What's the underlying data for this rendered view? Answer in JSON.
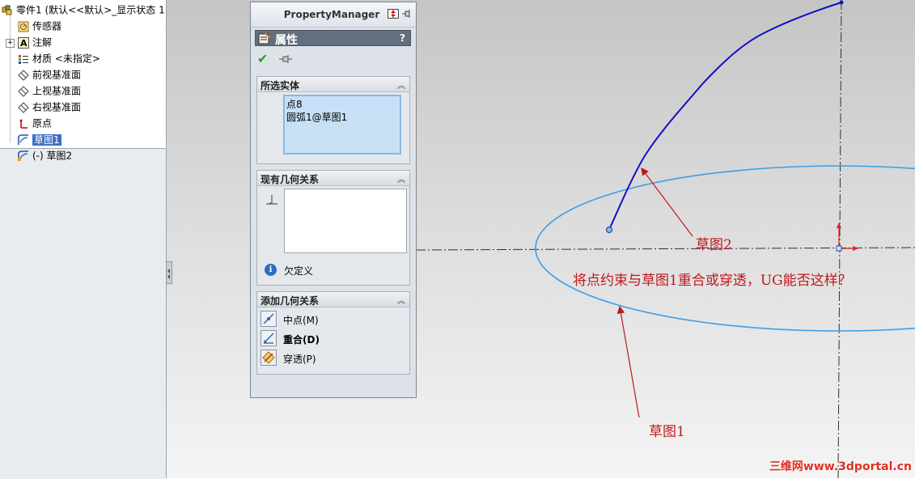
{
  "feature_tree": {
    "root": "零件1 (默认<<默认>_显示状态 1",
    "items": [
      {
        "label": "传感器",
        "icon": "sensor-icon"
      },
      {
        "label": "注解",
        "icon": "annotation-icon"
      },
      {
        "label": "材质 <未指定>",
        "icon": "material-icon"
      },
      {
        "label": "前视基准面",
        "icon": "plane-icon"
      },
      {
        "label": "上视基准面",
        "icon": "plane-icon"
      },
      {
        "label": "右视基准面",
        "icon": "plane-icon"
      },
      {
        "label": "原点",
        "icon": "origin-icon"
      },
      {
        "label": "草图1",
        "icon": "sketch-icon",
        "selected": true
      },
      {
        "label": "(-) 草图2",
        "icon": "sketch-icon"
      }
    ]
  },
  "property_manager": {
    "title": "PropertyManager",
    "header": "属性",
    "help": "?",
    "groups": {
      "selected_entities": {
        "title": "所选实体",
        "items": [
          "点8",
          "圆弧1@草图1"
        ]
      },
      "existing_relations": {
        "title": "现有几何关系",
        "status": "欠定义"
      },
      "add_relations": {
        "title": "添加几何关系",
        "items": [
          {
            "label": "中点(M)",
            "bold": false
          },
          {
            "label": "重合(D)",
            "bold": true
          },
          {
            "label": "穿透(P)",
            "bold": false
          }
        ]
      }
    }
  },
  "viewport": {
    "annotations": {
      "sketch2": "草图2",
      "question": "将点约束与草图1重合或穿透，UG能否这样？",
      "sketch1": "草图1"
    },
    "watermark": "三维网www.3dportal.cn"
  },
  "colors": {
    "arc": "#1010c8",
    "ellipse": "#3d9ee6",
    "annotation": "#c0171d",
    "pm_header": "#636f7c",
    "selection": "#3a6fc9"
  }
}
